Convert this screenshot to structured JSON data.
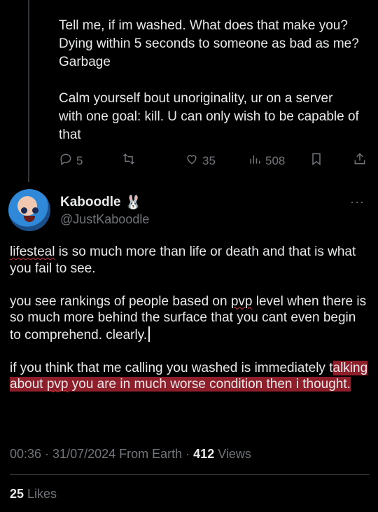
{
  "previous_tweet": {
    "text": "Tell me, if im washed. What does that make you? Dying within 5 seconds to someone as bad as me? Garbage\n\nCalm yourself bout unoriginality, ur on a server with one goal: kill. U can only wish to be capable of that",
    "actions": {
      "replies": "5",
      "likes": "35",
      "views": "508"
    }
  },
  "tweet": {
    "author_name": "Kaboodle",
    "author_emoji": "🐰",
    "handle": "@JustKaboodle",
    "more_label": "···",
    "p1_word1": "lifesteal",
    "p1_rest": " is so much more than life or death and that is what you fail to see.",
    "p2_before": "you see rankings of people based on ",
    "p2_word": "pvp",
    "p2_after": " level when there is so much more behind the surface that you cant even begin to comprehend. clearly.",
    "p3_plain": "if you think that me calling you washed is immediately t",
    "p3_highlight_a": "alking about ",
    "p3_highlight_word": "pvp",
    "p3_highlight_b": " you are in much worse condition then i thought."
  },
  "meta": {
    "time": "00:36",
    "sep1": " · ",
    "date": "31/07/2024",
    "source": " From Earth",
    "sep2": " · ",
    "views_count": "412",
    "views_label": " Views"
  },
  "engagement": {
    "likes_count": "25",
    "likes_label": " Likes"
  },
  "icons": {
    "reply": "reply-bubble-icon",
    "retweet": "retweet-icon",
    "like": "heart-icon",
    "views": "views-chart-icon",
    "bookmark": "bookmark-icon",
    "share": "share-icon"
  },
  "colors": {
    "background": "#000000",
    "text": "#e7e9ea",
    "muted": "#71767b",
    "highlight": "#8e1f2a",
    "spellcheck": "#d0353a"
  }
}
